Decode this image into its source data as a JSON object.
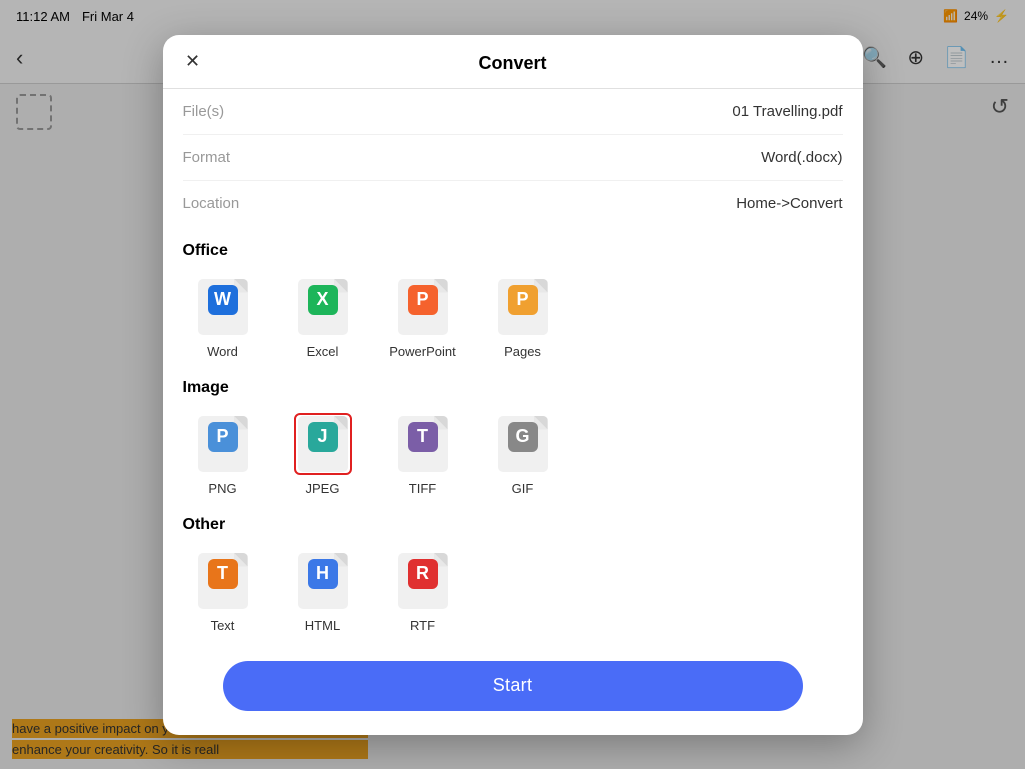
{
  "statusBar": {
    "time": "11:12 AM",
    "date": "Fri Mar 4",
    "battery": "24%",
    "batteryCharging": true
  },
  "toolbar": {
    "backLabel": "‹"
  },
  "dialog": {
    "title": "Convert",
    "closeLabel": "✕",
    "files_label": "File(s)",
    "files_value": "01 Travelling.pdf",
    "format_label": "Format",
    "format_value": "Word(.docx)",
    "location_label": "Location",
    "location_value": "Home->Convert",
    "office_section": "Office",
    "image_section": "Image",
    "other_section": "Other",
    "start_label": "Start",
    "formats": {
      "office": [
        {
          "id": "word",
          "letter": "W",
          "badgeClass": "badge-blue",
          "name": "Word",
          "selected": false
        },
        {
          "id": "excel",
          "letter": "X",
          "badgeClass": "badge-green",
          "name": "Excel",
          "selected": false
        },
        {
          "id": "powerpoint",
          "letter": "P",
          "badgeClass": "badge-orange",
          "name": "PowerPoint",
          "selected": false
        },
        {
          "id": "pages",
          "letter": "P",
          "badgeClass": "badge-yellow",
          "name": "Pages",
          "selected": false
        }
      ],
      "image": [
        {
          "id": "png",
          "letter": "P",
          "badgeClass": "badge-blue-light",
          "name": "PNG",
          "selected": false
        },
        {
          "id": "jpeg",
          "letter": "J",
          "badgeClass": "badge-teal",
          "name": "JPEG",
          "selected": true
        },
        {
          "id": "tiff",
          "letter": "T",
          "badgeClass": "badge-purple",
          "name": "TIFF",
          "selected": false
        },
        {
          "id": "gif",
          "letter": "G",
          "badgeClass": "badge-gray",
          "name": "GIF",
          "selected": false
        }
      ],
      "other": [
        {
          "id": "text",
          "letter": "T",
          "badgeClass": "badge-orange2",
          "name": "Text",
          "selected": false
        },
        {
          "id": "html",
          "letter": "H",
          "badgeClass": "badge-blue2",
          "name": "HTML",
          "selected": false
        },
        {
          "id": "rtf",
          "letter": "R",
          "badgeClass": "badge-red",
          "name": "RTF",
          "selected": false
        }
      ]
    }
  },
  "bottomText": {
    "line1": "have a positive impact on your health and",
    "line2": "enhance your creativity. So it is reall"
  }
}
